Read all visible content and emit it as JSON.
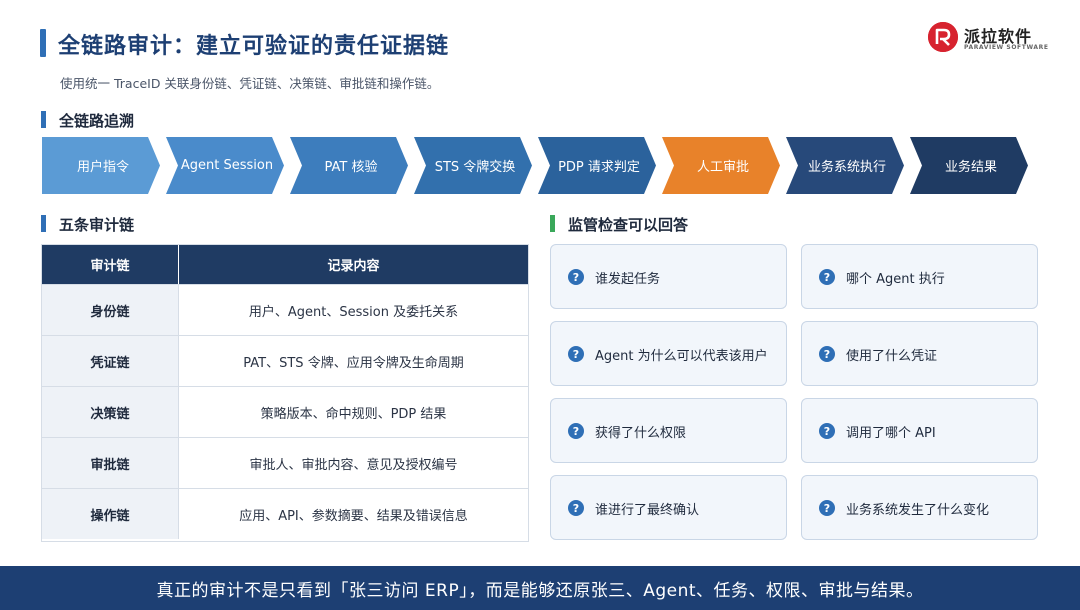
{
  "header": {
    "title": "全链路审计：建立可验证的责任证据链",
    "subtitle": "使用统一 TraceID 关联身份链、凭证链、决策链、审批链和操作链。",
    "logo_name": "派拉软件",
    "logo_sub": "PARAVIEW SOFTWARE"
  },
  "colors": {
    "brand_blue": "#1d3f73",
    "accent_orange": "#e8822a",
    "logo_red": "#d7232f"
  },
  "trace": {
    "heading": "全链路追溯",
    "steps": [
      {
        "label": "用户指令",
        "color": "#5b9bd5"
      },
      {
        "label": "Agent Session",
        "color": "#4a8bcb"
      },
      {
        "label": "PAT 核验",
        "color": "#3d7dbd"
      },
      {
        "label": "STS 令牌交换",
        "color": "#3270ad"
      },
      {
        "label": "PDP 请求判定",
        "color": "#2b629c"
      },
      {
        "label": "人工审批",
        "color": "#e8822a"
      },
      {
        "label": "业务系统执行",
        "color": "#27497a"
      },
      {
        "label": "业务结果",
        "color": "#1f3b63"
      }
    ]
  },
  "chains": {
    "heading": "五条审计链",
    "header_col1": "审计链",
    "header_col2": "记录内容",
    "rows": [
      {
        "name": "身份链",
        "content": "用户、Agent、Session 及委托关系"
      },
      {
        "name": "凭证链",
        "content": "PAT、STS 令牌、应用令牌及生命周期"
      },
      {
        "name": "决策链",
        "content": "策略版本、命中规则、PDP 结果"
      },
      {
        "name": "审批链",
        "content": "审批人、审批内容、意见及授权编号"
      },
      {
        "name": "操作链",
        "content": "应用、API、参数摘要、结果及错误信息"
      }
    ]
  },
  "questions": {
    "heading": "监管检查可以回答",
    "icon": "question-icon",
    "icon_glyph": "?",
    "items": [
      "谁发起任务",
      "哪个 Agent 执行",
      "Agent 为什么可以代表该用户",
      "使用了什么凭证",
      "获得了什么权限",
      "调用了哪个 API",
      "谁进行了最终确认",
      "业务系统发生了什么变化"
    ]
  },
  "footer": {
    "text": "真正的审计不是只看到「张三访问 ERP」，而是能够还原张三、Agent、任务、权限、审批与结果。"
  }
}
